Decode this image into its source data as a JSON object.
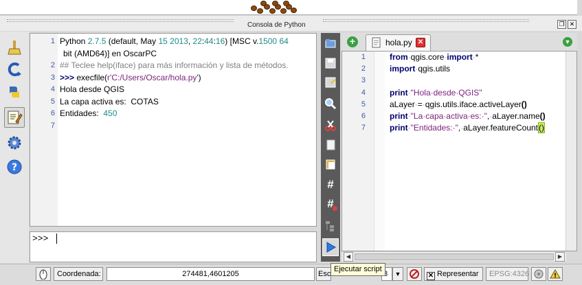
{
  "dock": {
    "title": "Consola de Python"
  },
  "console": {
    "lines": [
      {
        "n": "1",
        "segments": [
          [
            "t",
            "Python "
          ],
          [
            "num",
            "2.7.5"
          ],
          [
            "t",
            " (default, May "
          ],
          [
            "num",
            "15"
          ],
          [
            "t",
            " "
          ],
          [
            "num",
            "2013"
          ],
          [
            "t",
            ", "
          ],
          [
            "num",
            "22"
          ],
          [
            "t",
            ":"
          ],
          [
            "num",
            "44"
          ],
          [
            "t",
            ":"
          ],
          [
            "num",
            "16"
          ],
          [
            "t",
            ") [MSC v."
          ],
          [
            "num",
            "1500"
          ],
          [
            "t",
            " "
          ],
          [
            "num",
            "64"
          ]
        ]
      },
      {
        "n": "",
        "segments": [
          [
            "t",
            "bit (AMD64)] en OscarPC"
          ]
        ]
      },
      {
        "n": "2",
        "segments": [
          [
            "cmt",
            "## Teclee help(iface) para más información y lista de métodos."
          ]
        ]
      },
      {
        "n": "3",
        "segments": [
          [
            "kw",
            ">>> "
          ],
          [
            "t",
            "execfile("
          ],
          [
            "str",
            "r'C:/Users/Oscar/hola.py'"
          ],
          [
            "t",
            ")"
          ]
        ]
      },
      {
        "n": "4",
        "segments": [
          [
            "t",
            "Hola desde QGIS"
          ]
        ]
      },
      {
        "n": "5",
        "segments": [
          [
            "t",
            "La capa activa es:  COTAS"
          ]
        ]
      },
      {
        "n": "6",
        "segments": [
          [
            "t",
            "Entidades:  "
          ],
          [
            "num",
            "450"
          ]
        ]
      },
      {
        "n": "7",
        "segments": []
      }
    ],
    "input_prompt": ">>>"
  },
  "editor": {
    "tab_label": "hola.py",
    "lines": [
      {
        "n": "1",
        "segments": [
          [
            "kw",
            "from"
          ],
          [
            "dot",
            "·"
          ],
          [
            "t",
            "qgis.core"
          ],
          [
            "dot",
            "·"
          ],
          [
            "kw",
            "import"
          ],
          [
            "dot",
            "·"
          ],
          [
            "t",
            "*"
          ]
        ]
      },
      {
        "n": "2",
        "segments": [
          [
            "kw",
            "import"
          ],
          [
            "dot",
            "·"
          ],
          [
            "t",
            "qgis.utils"
          ]
        ]
      },
      {
        "n": "3",
        "segments": []
      },
      {
        "n": "4",
        "segments": [
          [
            "kw",
            "print"
          ],
          [
            "dot",
            "·"
          ],
          [
            "str",
            "\"Hola·desde·QGIS\""
          ]
        ]
      },
      {
        "n": "5",
        "segments": [
          [
            "t",
            "aLayer"
          ],
          [
            "dot",
            "·"
          ],
          [
            "t",
            "="
          ],
          [
            "dot",
            "·"
          ],
          [
            "t",
            "qgis.utils.iface.activeLayer"
          ],
          [
            "paren",
            "()"
          ]
        ]
      },
      {
        "n": "6",
        "segments": [
          [
            "kw",
            "print"
          ],
          [
            "dot",
            "·"
          ],
          [
            "str",
            "\"La·capa·activa·es:·\""
          ],
          [
            "t",
            ","
          ],
          [
            "dot",
            "·"
          ],
          [
            "t",
            "aLayer.name"
          ],
          [
            "paren",
            "()"
          ]
        ]
      },
      {
        "n": "7",
        "segments": [
          [
            "kw",
            "print"
          ],
          [
            "dot",
            "·"
          ],
          [
            "str",
            "\"Entidades:·\""
          ],
          [
            "t",
            ","
          ],
          [
            "dot",
            "·"
          ],
          [
            "t",
            "aLayer.featureCount"
          ],
          [
            "hl",
            "()"
          ]
        ]
      }
    ]
  },
  "tooltip": "Ejecutar script",
  "statusbar": {
    "coord_label": "Coordenada:",
    "coord_value": "274481,4601205",
    "scale_label_partial": "Esc",
    "scale_value_partial": "8",
    "render_label": "Representar",
    "epsg_label": "EPSG:4326"
  },
  "colors": {
    "accent_blue": "#3b5aa8",
    "keyword": "#00006e",
    "string": "#7a1f7a",
    "number": "#1e8a8a"
  },
  "icons": {
    "left_toolbar": [
      "clear-console-icon",
      "import-class-icon",
      "python-run-icon",
      "show-editor-icon",
      "settings-gear-icon",
      "help-icon"
    ],
    "editor_toolbar": [
      "open-file-icon",
      "save-file-icon",
      "save-as-icon",
      "find-icon",
      "cut-icon",
      "copy-icon",
      "paste-icon",
      "comment-icon",
      "uncomment-icon",
      "object-inspector-icon",
      "run-script-icon"
    ]
  }
}
